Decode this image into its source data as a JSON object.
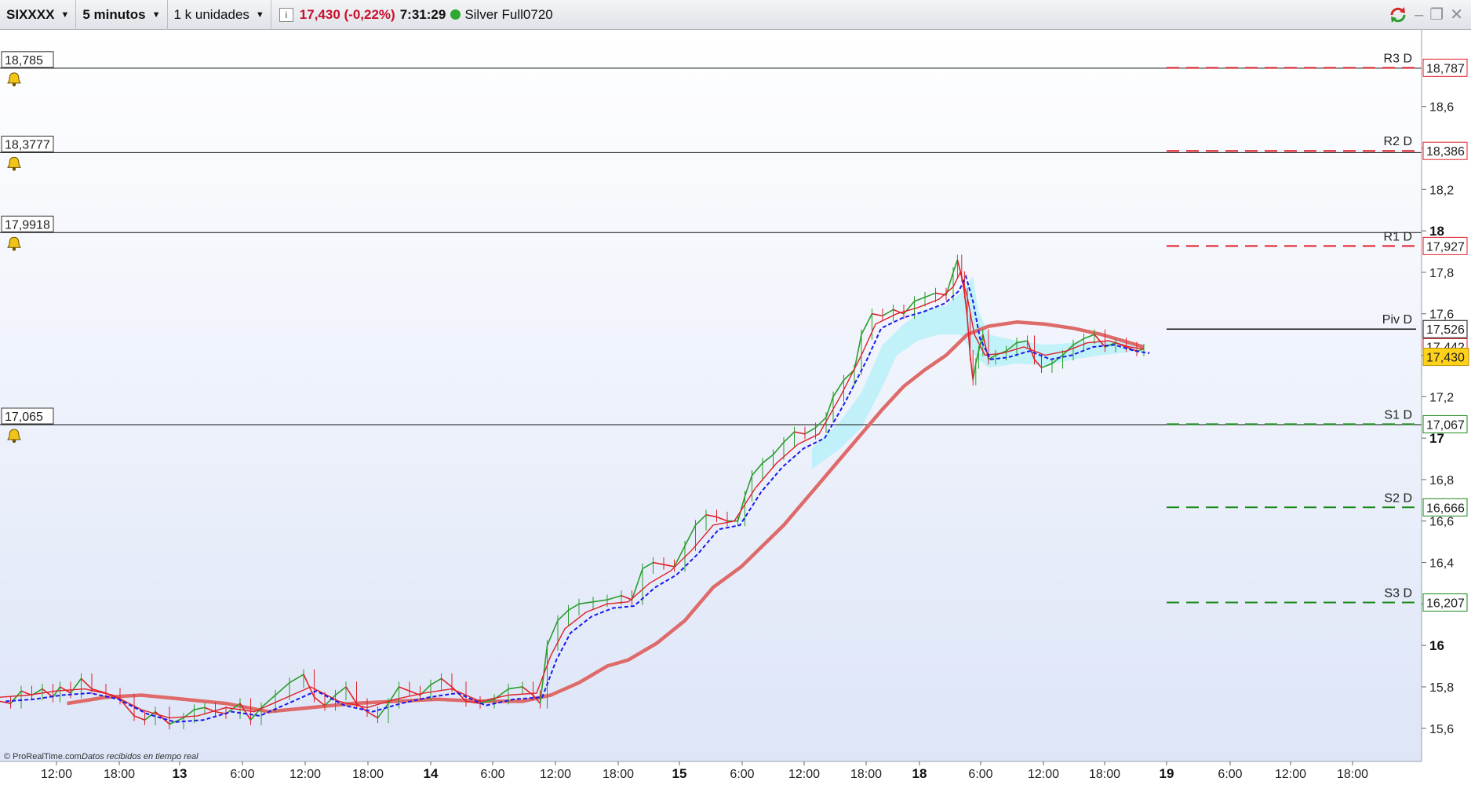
{
  "toolbar": {
    "instrument": "SIXXXX",
    "timeframe": "5 minutos",
    "units": "1 k unidades",
    "info_icon": "i",
    "price_change": "17,430 (-0,22%)",
    "time": "7:31:29",
    "status_label": "Silver Full0720",
    "status_color": "#2fa82f"
  },
  "footer": {
    "copyright": "© ProRealTime.com",
    "realtime": "Datos recibidos en tiempo real"
  },
  "colors": {
    "price_up": "#2a9d2a",
    "price_down": "#e0202a",
    "ma_long": "#de6a6a",
    "ma_fast_dashed": "#1a1aee",
    "ma_fast_red": "#e0202a",
    "cloud": "#b8f0f8",
    "cloud_green": "#a8f0b0",
    "resistance": "#e0202a",
    "support": "#1a8a1a",
    "last_price_bg": "#ffd21a"
  },
  "chart_data": {
    "type": "line",
    "instrument": "SIXXXX",
    "timeframe": "5 minutos",
    "ylim": [
      15.44,
      18.97
    ],
    "x_ticks": [
      "12:00",
      "18:00",
      "13",
      "6:00",
      "12:00",
      "18:00",
      "14",
      "6:00",
      "12:00",
      "18:00",
      "15",
      "6:00",
      "12:00",
      "18:00",
      "18",
      "6:00",
      "12:00",
      "18:00",
      "19",
      "6:00",
      "12:00",
      "18:00"
    ],
    "x_ticks_bold": [
      false,
      false,
      true,
      false,
      false,
      false,
      true,
      false,
      false,
      false,
      true,
      false,
      false,
      false,
      true,
      false,
      false,
      false,
      true,
      false,
      false,
      false
    ],
    "y_ticks": [
      "15,6",
      "15,8",
      "16",
      "16,2",
      "16,4",
      "16,6",
      "16,8",
      "17",
      "17,2",
      "17,4",
      "17,6",
      "17,8",
      "18",
      "18,2",
      "18,4",
      "18,6"
    ],
    "y_tick_values": [
      15.6,
      15.8,
      16.0,
      16.2,
      16.4,
      16.6,
      16.8,
      17.0,
      17.2,
      17.4,
      17.6,
      17.8,
      18.0,
      18.2,
      18.4,
      18.6
    ],
    "y_ticks_bold": [
      false,
      false,
      true,
      false,
      false,
      false,
      false,
      true,
      false,
      false,
      false,
      false,
      true,
      false,
      false,
      false
    ],
    "alert_lines": [
      {
        "label": "18,785",
        "value": 18.785
      },
      {
        "label": "18,3777",
        "value": 18.3777
      },
      {
        "label": "17,9918",
        "value": 17.9918
      },
      {
        "label": "17,065",
        "value": 17.065
      }
    ],
    "pivot_levels": [
      {
        "name": "R3 D",
        "label": "18,787",
        "value": 18.787,
        "kind": "resistance"
      },
      {
        "name": "R2 D",
        "label": "18,386",
        "value": 18.386,
        "kind": "resistance"
      },
      {
        "name": "R1 D",
        "label": "17,927",
        "value": 17.927,
        "kind": "resistance"
      },
      {
        "name": "Piv D",
        "label": "17,526",
        "value": 17.526,
        "kind": "pivot"
      },
      {
        "name": "S1 D",
        "label": "17,067",
        "value": 17.067,
        "kind": "support"
      },
      {
        "name": "S2 D",
        "label": "16,666",
        "value": 16.666,
        "kind": "support"
      },
      {
        "name": "S3 D",
        "label": "16,207",
        "value": 16.207,
        "kind": "support"
      }
    ],
    "ma_label": "17,442",
    "ma_value": 17.442,
    "last_price_label": "17,430",
    "last_price": 17.43,
    "price_path": [
      [
        0,
        15.73
      ],
      [
        15,
        15.72
      ],
      [
        30,
        15.78
      ],
      [
        45,
        15.76
      ],
      [
        60,
        15.79
      ],
      [
        75,
        15.75
      ],
      [
        85,
        15.8
      ],
      [
        100,
        15.77
      ],
      [
        115,
        15.84
      ],
      [
        130,
        15.79
      ],
      [
        150,
        15.77
      ],
      [
        170,
        15.74
      ],
      [
        190,
        15.66
      ],
      [
        205,
        15.64
      ],
      [
        220,
        15.68
      ],
      [
        240,
        15.62
      ],
      [
        260,
        15.65
      ],
      [
        275,
        15.69
      ],
      [
        290,
        15.7
      ],
      [
        305,
        15.68
      ],
      [
        320,
        15.67
      ],
      [
        340,
        15.72
      ],
      [
        355,
        15.64
      ],
      [
        370,
        15.7
      ],
      [
        390,
        15.76
      ],
      [
        410,
        15.82
      ],
      [
        430,
        15.86
      ],
      [
        445,
        15.75
      ],
      [
        460,
        15.71
      ],
      [
        475,
        15.76
      ],
      [
        490,
        15.8
      ],
      [
        505,
        15.72
      ],
      [
        520,
        15.68
      ],
      [
        535,
        15.65
      ],
      [
        550,
        15.72
      ],
      [
        565,
        15.8
      ],
      [
        580,
        15.78
      ],
      [
        595,
        15.76
      ],
      [
        610,
        15.81
      ],
      [
        625,
        15.84
      ],
      [
        640,
        15.8
      ],
      [
        660,
        15.73
      ],
      [
        680,
        15.72
      ],
      [
        700,
        15.74
      ],
      [
        720,
        15.79
      ],
      [
        740,
        15.8
      ],
      [
        755,
        15.76
      ],
      [
        765,
        15.72
      ],
      [
        775,
        16.0
      ],
      [
        790,
        16.12
      ],
      [
        805,
        16.17
      ],
      [
        820,
        16.2
      ],
      [
        840,
        16.21
      ],
      [
        860,
        16.22
      ],
      [
        880,
        16.24
      ],
      [
        895,
        16.22
      ],
      [
        910,
        16.37
      ],
      [
        925,
        16.4
      ],
      [
        940,
        16.39
      ],
      [
        955,
        16.38
      ],
      [
        970,
        16.48
      ],
      [
        985,
        16.58
      ],
      [
        1000,
        16.63
      ],
      [
        1015,
        16.62
      ],
      [
        1030,
        16.6
      ],
      [
        1045,
        16.6
      ],
      [
        1055,
        16.72
      ],
      [
        1065,
        16.82
      ],
      [
        1080,
        16.88
      ],
      [
        1095,
        16.92
      ],
      [
        1110,
        16.98
      ],
      [
        1125,
        17.03
      ],
      [
        1140,
        17.02
      ],
      [
        1155,
        17.05
      ],
      [
        1170,
        17.1
      ],
      [
        1180,
        17.2
      ],
      [
        1195,
        17.28
      ],
      [
        1210,
        17.33
      ],
      [
        1220,
        17.5
      ],
      [
        1235,
        17.6
      ],
      [
        1250,
        17.59
      ],
      [
        1265,
        17.62
      ],
      [
        1280,
        17.6
      ],
      [
        1295,
        17.66
      ],
      [
        1310,
        17.68
      ],
      [
        1325,
        17.7
      ],
      [
        1340,
        17.69
      ],
      [
        1350,
        17.8
      ],
      [
        1356,
        17.86
      ],
      [
        1362,
        17.78
      ],
      [
        1366,
        17.7
      ],
      [
        1370,
        17.58
      ],
      [
        1374,
        17.4
      ],
      [
        1378,
        17.28
      ],
      [
        1382,
        17.36
      ],
      [
        1386,
        17.42
      ],
      [
        1392,
        17.5
      ],
      [
        1400,
        17.38
      ],
      [
        1410,
        17.4
      ],
      [
        1425,
        17.42
      ],
      [
        1440,
        17.46
      ],
      [
        1455,
        17.47
      ],
      [
        1465,
        17.38
      ],
      [
        1475,
        17.34
      ],
      [
        1490,
        17.36
      ],
      [
        1505,
        17.4
      ],
      [
        1520,
        17.45
      ],
      [
        1535,
        17.48
      ],
      [
        1550,
        17.5
      ],
      [
        1565,
        17.44
      ],
      [
        1580,
        17.46
      ],
      [
        1595,
        17.44
      ],
      [
        1610,
        17.42
      ],
      [
        1620,
        17.43
      ]
    ],
    "ma_long_path": [
      [
        95,
        15.72
      ],
      [
        150,
        15.75
      ],
      [
        200,
        15.76
      ],
      [
        260,
        15.74
      ],
      [
        320,
        15.72
      ],
      [
        380,
        15.68
      ],
      [
        440,
        15.7
      ],
      [
        500,
        15.72
      ],
      [
        560,
        15.73
      ],
      [
        620,
        15.74
      ],
      [
        680,
        15.73
      ],
      [
        740,
        15.73
      ],
      [
        780,
        15.76
      ],
      [
        820,
        15.82
      ],
      [
        860,
        15.9
      ],
      [
        890,
        15.93
      ],
      [
        930,
        16.01
      ],
      [
        970,
        16.12
      ],
      [
        1010,
        16.28
      ],
      [
        1050,
        16.38
      ],
      [
        1080,
        16.48
      ],
      [
        1110,
        16.58
      ],
      [
        1150,
        16.74
      ],
      [
        1190,
        16.9
      ],
      [
        1220,
        17.02
      ],
      [
        1250,
        17.14
      ],
      [
        1280,
        17.25
      ],
      [
        1310,
        17.33
      ],
      [
        1340,
        17.4
      ],
      [
        1370,
        17.5
      ],
      [
        1400,
        17.54
      ],
      [
        1440,
        17.56
      ],
      [
        1480,
        17.55
      ],
      [
        1520,
        17.53
      ],
      [
        1560,
        17.5
      ],
      [
        1590,
        17.47
      ],
      [
        1620,
        17.44
      ]
    ],
    "ma_fast_path": [
      [
        0,
        15.75
      ],
      [
        40,
        15.76
      ],
      [
        80,
        15.78
      ],
      [
        120,
        15.79
      ],
      [
        160,
        15.76
      ],
      [
        200,
        15.69
      ],
      [
        240,
        15.65
      ],
      [
        280,
        15.66
      ],
      [
        320,
        15.7
      ],
      [
        360,
        15.68
      ],
      [
        400,
        15.74
      ],
      [
        440,
        15.8
      ],
      [
        480,
        15.73
      ],
      [
        520,
        15.7
      ],
      [
        560,
        15.74
      ],
      [
        600,
        15.77
      ],
      [
        640,
        15.79
      ],
      [
        680,
        15.73
      ],
      [
        720,
        15.76
      ],
      [
        760,
        15.77
      ],
      [
        780,
        15.95
      ],
      [
        800,
        16.08
      ],
      [
        830,
        16.16
      ],
      [
        860,
        16.2
      ],
      [
        890,
        16.21
      ],
      [
        920,
        16.3
      ],
      [
        950,
        16.36
      ],
      [
        980,
        16.46
      ],
      [
        1010,
        16.58
      ],
      [
        1040,
        16.6
      ],
      [
        1070,
        16.76
      ],
      [
        1100,
        16.88
      ],
      [
        1130,
        16.97
      ],
      [
        1160,
        17.02
      ],
      [
        1190,
        17.2
      ],
      [
        1220,
        17.4
      ],
      [
        1240,
        17.55
      ],
      [
        1270,
        17.6
      ],
      [
        1300,
        17.63
      ],
      [
        1330,
        17.67
      ],
      [
        1350,
        17.73
      ],
      [
        1360,
        17.8
      ],
      [
        1370,
        17.68
      ],
      [
        1380,
        17.5
      ],
      [
        1395,
        17.4
      ],
      [
        1420,
        17.41
      ],
      [
        1450,
        17.44
      ],
      [
        1480,
        17.4
      ],
      [
        1510,
        17.42
      ],
      [
        1540,
        17.46
      ],
      [
        1570,
        17.47
      ],
      [
        1600,
        17.44
      ],
      [
        1620,
        17.43
      ]
    ],
    "cloud_polygon": [
      [
        1150,
        16.95
      ],
      [
        1190,
        17.08
      ],
      [
        1220,
        17.22
      ],
      [
        1250,
        17.45
      ],
      [
        1280,
        17.55
      ],
      [
        1310,
        17.62
      ],
      [
        1340,
        17.64
      ],
      [
        1360,
        17.7
      ],
      [
        1378,
        17.78
      ],
      [
        1385,
        17.62
      ],
      [
        1400,
        17.5
      ],
      [
        1440,
        17.47
      ],
      [
        1480,
        17.45
      ],
      [
        1520,
        17.46
      ],
      [
        1560,
        17.47
      ],
      [
        1610,
        17.46
      ],
      [
        1610,
        17.42
      ],
      [
        1560,
        17.4
      ],
      [
        1520,
        17.38
      ],
      [
        1480,
        17.35
      ],
      [
        1440,
        17.36
      ],
      [
        1400,
        17.34
      ],
      [
        1385,
        17.38
      ],
      [
        1360,
        17.5
      ],
      [
        1330,
        17.5
      ],
      [
        1300,
        17.47
      ],
      [
        1270,
        17.4
      ],
      [
        1250,
        17.25
      ],
      [
        1220,
        17.05
      ],
      [
        1190,
        16.95
      ],
      [
        1150,
        16.85
      ]
    ]
  }
}
